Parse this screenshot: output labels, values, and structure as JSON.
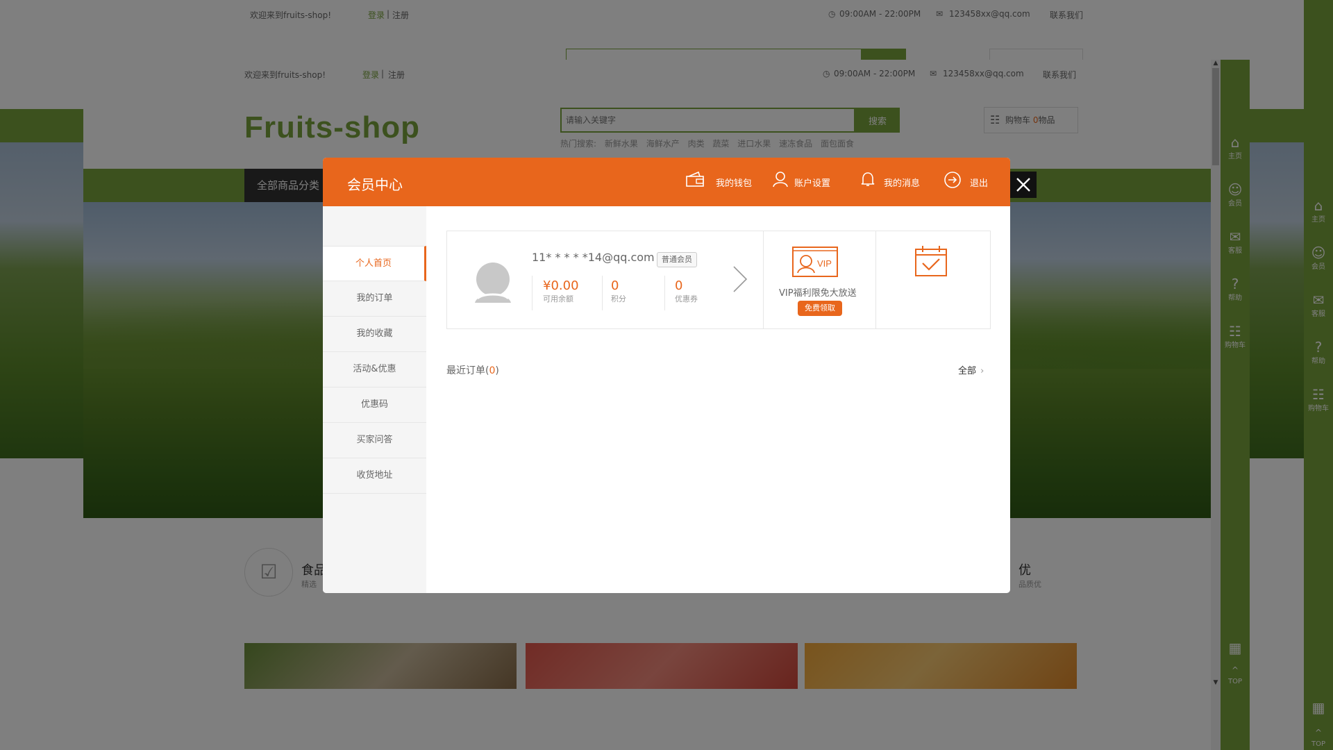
{
  "outer": {
    "welcome": "欢迎来到fruits-shop!",
    "login": "登录",
    "divider": "|",
    "register": "注册",
    "hours": "09:00AM - 22:00PM",
    "email": "123458xx@qq.com",
    "contact": "联系我们",
    "rail": [
      {
        "icon": "home-icon",
        "label": "主页"
      },
      {
        "icon": "member-icon",
        "label": "会员"
      },
      {
        "icon": "chat-icon",
        "label": "客服"
      },
      {
        "icon": "help-icon",
        "label": "帮助"
      },
      {
        "icon": "cart-icon",
        "label": "购物车"
      },
      {
        "icon": "qr-icon",
        "label": ""
      },
      {
        "icon": "top-icon",
        "label": "TOP"
      }
    ]
  },
  "site": {
    "welcome": "欢迎来到fruits-shop!",
    "login": "登录",
    "divider": "|",
    "register": "注册",
    "hours": "09:00AM - 22:00PM",
    "email": "123458xx@qq.com",
    "contact": "联系我们",
    "logo": "Fruits-shop",
    "search_placeholder": "请输入关键字",
    "search_button": "搜索",
    "hot_searches": [
      "热门搜索:",
      "新鲜水果",
      "海鲜水产",
      "肉类",
      "蔬菜",
      "进口水果",
      "速冻食品",
      "面包面食"
    ],
    "cart_prefix": "购物车",
    "cart_count": "0",
    "cart_suffix": "物品",
    "all_categories": "全部商品分类",
    "features": [
      {
        "icon": "basket-icon",
        "title": "食品",
        "sub": "精选"
      },
      {
        "icon": "",
        "title": "优",
        "sub": "品质优"
      }
    ],
    "rail": [
      {
        "icon": "home-icon",
        "label": "主页"
      },
      {
        "icon": "member-icon",
        "label": "会员"
      },
      {
        "icon": "chat-icon",
        "label": "客服"
      },
      {
        "icon": "help-icon",
        "label": "帮助"
      },
      {
        "icon": "cart-icon",
        "label": "购物车"
      },
      {
        "icon": "qr-icon",
        "label": ""
      },
      {
        "icon": "top-icon",
        "label": "TOP"
      }
    ]
  },
  "modal": {
    "title": "会员中心",
    "nav": [
      {
        "icon": "wallet-icon",
        "label": "我的钱包"
      },
      {
        "icon": "user-icon",
        "label": "账户设置"
      },
      {
        "icon": "bell-icon",
        "label": "我的消息"
      },
      {
        "icon": "logout-icon",
        "label": "退出"
      }
    ],
    "sidebar": [
      "个人首页",
      "我的订单",
      "我的收藏",
      "活动&优惠",
      "优惠码",
      "买家问答",
      "收货地址"
    ],
    "active_index": 0,
    "user": {
      "email": "11* * * * *14@qq.com",
      "level": "普通会员",
      "balance": "¥0.00",
      "balance_label": "可用余额",
      "points": "0",
      "points_label": "积分",
      "coupons": "0",
      "coupons_label": "优惠券"
    },
    "vip": {
      "text": "VIP福利限免大放送",
      "button": "免费领取",
      "badge": "VIP"
    },
    "orders": {
      "label": "最近订单",
      "open": "(",
      "count": "0",
      "close": ")",
      "all": "全部"
    }
  },
  "colors": {
    "accent": "#e8661c",
    "brand_green": "#78a23c"
  }
}
